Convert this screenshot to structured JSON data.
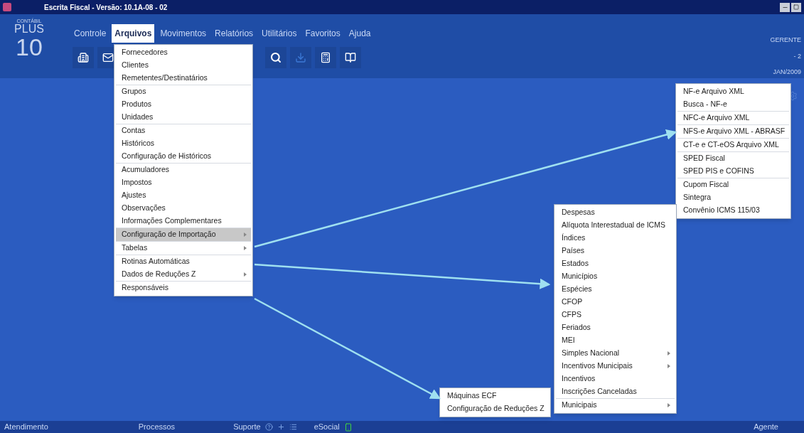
{
  "window": {
    "title": "Escrita Fiscal  - Versão: 10.1A-08 - 02"
  },
  "logo": {
    "line_1": "CONTÁBIL",
    "line_2": "PLUS",
    "line_3": "10"
  },
  "menu_bar": [
    {
      "label": "Controle",
      "selected": false
    },
    {
      "label": "Arquivos",
      "selected": true
    },
    {
      "label": "Movimentos",
      "selected": false
    },
    {
      "label": "Relatórios",
      "selected": false
    },
    {
      "label": "Utilitários",
      "selected": false
    },
    {
      "label": "Favoritos",
      "selected": false
    },
    {
      "label": "Ajuda",
      "selected": false
    }
  ],
  "user_info": {
    "user": "GERENTE",
    "company": "- 2",
    "period": "JAN/2009"
  },
  "arquivos_menu": [
    [
      {
        "label": "Fornecedores",
        "submenu": false,
        "selected": false
      },
      {
        "label": "Clientes",
        "submenu": false,
        "selected": false
      },
      {
        "label": "Remetentes/Destinatários",
        "submenu": false,
        "selected": false
      }
    ],
    [
      {
        "label": "Grupos",
        "submenu": false,
        "selected": false
      },
      {
        "label": "Produtos",
        "submenu": false,
        "selected": false
      },
      {
        "label": "Unidades",
        "submenu": false,
        "selected": false
      }
    ],
    [
      {
        "label": "Contas",
        "submenu": false,
        "selected": false
      },
      {
        "label": "Históricos",
        "submenu": false,
        "selected": false
      },
      {
        "label": "Configuração de Históricos",
        "submenu": false,
        "selected": false
      }
    ],
    [
      {
        "label": "Acumuladores",
        "submenu": false,
        "selected": false
      },
      {
        "label": "Impostos",
        "submenu": false,
        "selected": false
      },
      {
        "label": "Ajustes",
        "submenu": false,
        "selected": false
      },
      {
        "label": "Observações",
        "submenu": false,
        "selected": false
      },
      {
        "label": "Informações Complementares",
        "submenu": false,
        "selected": false
      }
    ],
    [
      {
        "label": "Configuração de Importação",
        "submenu": true,
        "selected": true
      }
    ],
    [
      {
        "label": "Tabelas",
        "submenu": true,
        "selected": false
      }
    ],
    [
      {
        "label": "Rotinas Automáticas",
        "submenu": false,
        "selected": false
      },
      {
        "label": "Dados de Reduções Z",
        "submenu": true,
        "selected": false
      }
    ],
    [
      {
        "label": "Responsáveis",
        "submenu": false,
        "selected": false
      }
    ]
  ],
  "importacao_submenu": [
    [
      {
        "label": "NF-e Arquivo XML",
        "submenu": false
      },
      {
        "label": "Busca - NF-e",
        "submenu": false
      }
    ],
    [
      {
        "label": "NFC-e Arquivo XML",
        "submenu": false
      }
    ],
    [
      {
        "label": "NFS-e Arquivo XML - ABRASF",
        "submenu": false
      }
    ],
    [
      {
        "label": "CT-e e CT-eOS Arquivo XML",
        "submenu": false
      }
    ],
    [
      {
        "label": "SPED Fiscal",
        "submenu": false
      },
      {
        "label": "SPED PIS e COFINS",
        "submenu": false
      }
    ],
    [
      {
        "label": "Cupom Fiscal",
        "submenu": false
      },
      {
        "label": "Sintegra",
        "submenu": false
      },
      {
        "label": "Convênio ICMS 115/03",
        "submenu": false
      }
    ]
  ],
  "tabelas_submenu": [
    [
      {
        "label": "Despesas",
        "submenu": false
      },
      {
        "label": "Alíquota Interestadual de ICMS",
        "submenu": false
      },
      {
        "label": "Índices",
        "submenu": false
      },
      {
        "label": "Países",
        "submenu": false
      },
      {
        "label": "Estados",
        "submenu": false
      },
      {
        "label": "Municípios",
        "submenu": false
      },
      {
        "label": "Espécies",
        "submenu": false
      },
      {
        "label": "CFOP",
        "submenu": false
      },
      {
        "label": "CFPS",
        "submenu": false
      },
      {
        "label": "Feriados",
        "submenu": false
      },
      {
        "label": "MEI",
        "submenu": false
      },
      {
        "label": "Simples Nacional",
        "submenu": true
      },
      {
        "label": "Incentivos Municipais",
        "submenu": true
      },
      {
        "label": "Incentivos",
        "submenu": false
      },
      {
        "label": "Inscrições Canceladas",
        "submenu": false
      }
    ],
    [
      {
        "label": "Municipais",
        "submenu": true
      }
    ]
  ],
  "reducoes_submenu": [
    [
      {
        "label": "Máquinas ECF",
        "submenu": false
      },
      {
        "label": "Configuração de Reduções Z",
        "submenu": false
      }
    ]
  ],
  "status_bar": [
    {
      "label": "Atendimento"
    },
    {
      "label": "Processos"
    },
    {
      "label": "Suporte"
    },
    {
      "label": "eSocial"
    },
    {
      "label": "Agente"
    }
  ]
}
